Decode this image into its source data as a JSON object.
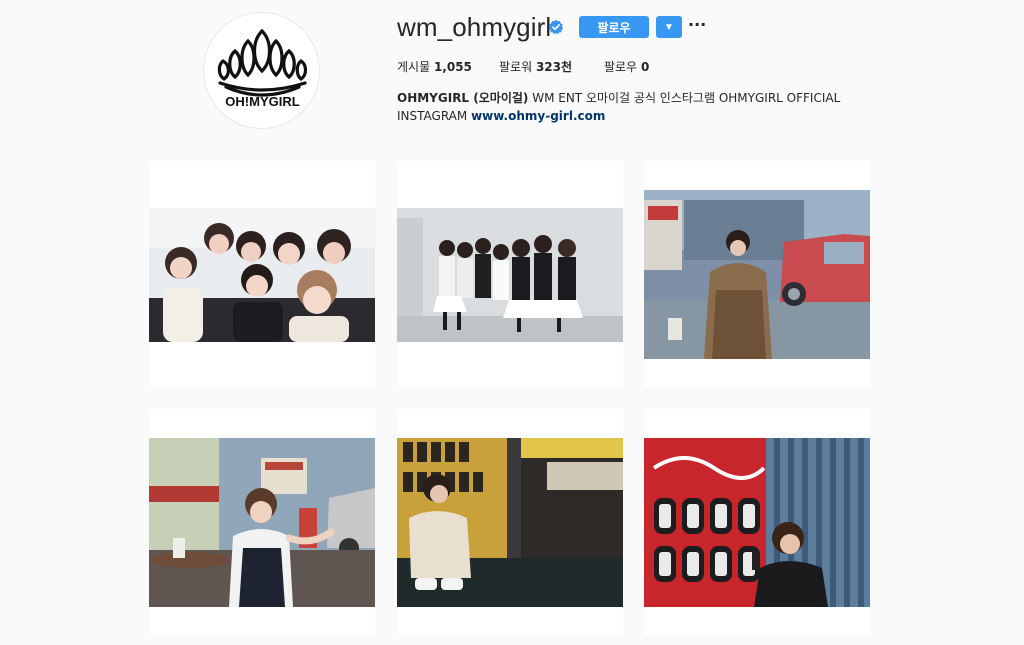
{
  "profile": {
    "username": "wm_ohmygirl",
    "verified_icon": "verified-badge-icon",
    "follow_label": "팔로우",
    "dropdown_icon": "▼",
    "more_icon": "···",
    "avatar_logo_text": "OH!MYGIRL",
    "stats": {
      "posts_label": "게시물",
      "posts_value": "1,055",
      "followers_label": "팔로워",
      "followers_value": "323천",
      "following_label": "팔로우",
      "following_value": "0"
    },
    "bio": {
      "name": "OHMYGIRL (오마이걸)",
      "text": " WM ENT 오마이걸 공식 인스타그램 OHMYGIRL OFFICIAL INSTAGRAM ",
      "link": "www.ohmy-girl.com"
    }
  },
  "colors": {
    "accent": "#3897f0",
    "background": "#fafafa",
    "link": "#003569"
  },
  "posts": [
    {
      "id": "post-1",
      "scene": "group-selfie"
    },
    {
      "id": "post-2",
      "scene": "group-backstage"
    },
    {
      "id": "post-3",
      "scene": "parking-lot"
    },
    {
      "id": "post-4",
      "scene": "drive-in-diner"
    },
    {
      "id": "post-5",
      "scene": "yellow-wall"
    },
    {
      "id": "post-6",
      "scene": "vending-machine"
    }
  ]
}
